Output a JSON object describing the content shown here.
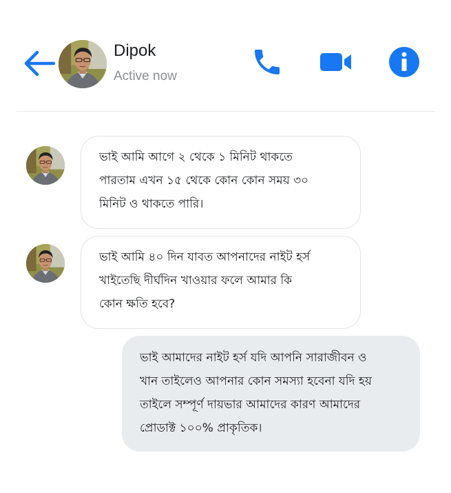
{
  "header": {
    "contact_name": "Dipok",
    "status": "Active now",
    "accent_color": "#1877f2",
    "icons": [
      "back-arrow-icon",
      "phone-icon",
      "video-camera-icon",
      "info-icon"
    ]
  },
  "messages": [
    {
      "direction": "incoming",
      "lines": [
        "ভাই আমি আগে ২ থেকে ১ মিনিট থাকতে",
        "পারতাম এখন ১৫ থেকে কোন কোন সময় ৩০",
        "মিনিট ও থাকতে পারি।"
      ]
    },
    {
      "direction": "incoming",
      "lines": [
        "ভাই আমি ৪০ দিন যাবত আপনাদের নাইট হর্স",
        "খাইতেছি দীর্ঘদিন খাওয়ার ফলে আমার কি",
        "কোন ক্ষতি হবে?"
      ]
    },
    {
      "direction": "outgoing",
      "lines": [
        "ভাই আমাদের নাইট হর্স যদি আপনি সারাজীবন ও",
        "খান তাইলেও আপনার কোন সমস্যা হবেনা যদি হয়",
        "তাইলে সম্পূর্ণ দায়ভার আমাদের কারণ আমাদের",
        "প্রোডাক্ট ১০০% প্রাকৃতিক।"
      ]
    }
  ],
  "colors": {
    "incoming_bubble": "#ffffff",
    "outgoing_bubble": "#e9ecef",
    "divider": "#e4e6eb",
    "status_text": "#8a8d91"
  }
}
